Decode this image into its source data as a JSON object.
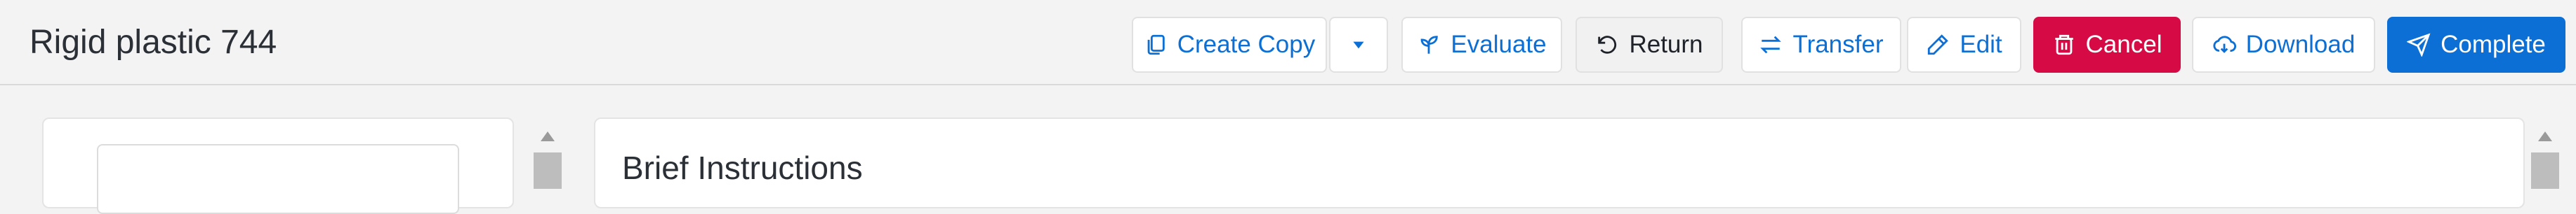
{
  "header": {
    "title": "Rigid plastic 744"
  },
  "toolbar": {
    "create_copy": {
      "label": "Create Copy",
      "icon": "copy-icon"
    },
    "more_options": {
      "icon": "caret-down-icon"
    },
    "evaluate": {
      "label": "Evaluate",
      "icon": "sprout-icon"
    },
    "return": {
      "label": "Return",
      "icon": "undo-icon"
    },
    "transfer": {
      "label": "Transfer",
      "icon": "transfer-arrows-icon"
    },
    "edit": {
      "label": "Edit",
      "icon": "pencil-icon"
    },
    "cancel": {
      "label": "Cancel",
      "icon": "trash-icon"
    },
    "download": {
      "label": "Download",
      "icon": "cloud-download-icon"
    },
    "complete": {
      "label": "Complete",
      "icon": "send-icon"
    }
  },
  "main": {
    "section_title": "Brief Instructions"
  },
  "colors": {
    "primary": "#0b6fd6",
    "danger": "#d60b45",
    "background": "#f3f3f3",
    "text": "#2b2f36"
  }
}
